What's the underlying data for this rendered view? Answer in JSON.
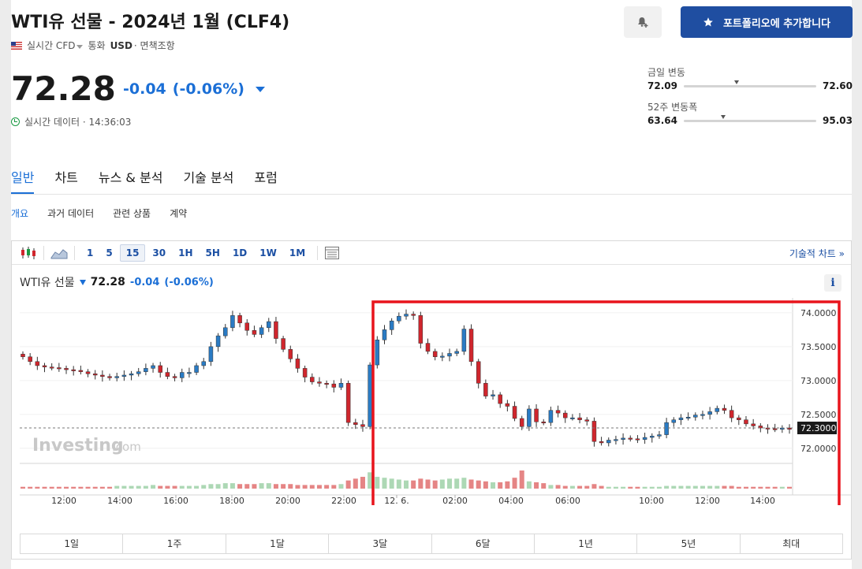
{
  "header": {
    "title": "WTI유 선물 - 2024년 1월 (CLF4)",
    "add_button_label": "포트폴리오에 추가합니다",
    "source": "실시간 CFD",
    "currency_label": "통화",
    "currency": "USD",
    "tax": "· 면책조항"
  },
  "quote": {
    "price": "72.28",
    "change": "-0.04",
    "change_pct": "(-0.06%)",
    "realtime_text": "실시간 데이터 · 14:36:03"
  },
  "ranges": {
    "day_label": "금일 변동",
    "day_low": "72.09",
    "day_high": "72.60",
    "day_pos": 0.38,
    "week52_label": "52주 변동폭",
    "week52_low": "63.64",
    "week52_high": "95.03",
    "week52_pos": 0.28
  },
  "tabs": [
    "일반",
    "차트",
    "뉴스 & 분석",
    "기술 분석",
    "포럼"
  ],
  "subtabs": [
    "개요",
    "과거 데이터",
    "관련 상품",
    "계약"
  ],
  "toolbar": {
    "intervals": [
      "1",
      "5",
      "15",
      "30",
      "1H",
      "5H",
      "1D",
      "1W",
      "1M"
    ],
    "active_interval": "15",
    "tech_chart_link": "기술적 차트 »"
  },
  "chart_head": {
    "name": "WTI유 선물",
    "price": "72.28",
    "change": "-0.04",
    "change_pct": "(-0.06%)"
  },
  "watermark": {
    "brand": "Investing",
    "suffix": ".com"
  },
  "periods": [
    "1일",
    "1주",
    "1달",
    "3달",
    "6달",
    "1년",
    "5년",
    "최대"
  ],
  "colors": {
    "up": "#2a7bc4",
    "down": "#d0262d",
    "accent": "#1b6fd6",
    "button": "#1f4ea1",
    "highlight": "#e8141c"
  },
  "chart_data": {
    "type": "candlestick",
    "interval": "15m",
    "x_ticks": [
      "12:00",
      "14:00",
      "16:00",
      "18:00",
      "20:00",
      "22:00",
      "12. 6.",
      "02:00",
      "04:00",
      "06:00",
      "10:00",
      "12:00",
      "14:00"
    ],
    "y_ticks": [
      "74.0000",
      "73.5000",
      "73.0000",
      "72.5000",
      "72.0000"
    ],
    "ylim": [
      71.8,
      74.15
    ],
    "current_price_label": "72.3000",
    "current_price": 72.3,
    "closes": [
      73.35,
      73.28,
      73.22,
      73.2,
      73.19,
      73.18,
      73.16,
      73.15,
      73.13,
      73.1,
      73.08,
      73.06,
      73.04,
      73.06,
      73.08,
      73.1,
      73.13,
      73.18,
      73.22,
      73.12,
      73.06,
      73.04,
      73.12,
      73.12,
      73.22,
      73.28,
      73.5,
      73.66,
      73.78,
      73.96,
      73.85,
      73.74,
      73.68,
      73.78,
      73.87,
      73.62,
      73.46,
      73.32,
      73.18,
      73.05,
      72.98,
      72.96,
      72.95,
      72.9,
      72.96,
      72.38,
      72.35,
      72.32,
      73.23,
      73.6,
      73.75,
      73.88,
      73.95,
      73.98,
      73.96,
      73.55,
      73.43,
      73.35,
      73.36,
      73.4,
      73.43,
      73.76,
      73.28,
      72.96,
      72.77,
      72.79,
      72.66,
      72.62,
      72.44,
      72.32,
      72.58,
      72.39,
      72.38,
      72.56,
      72.52,
      72.45,
      72.45,
      72.42,
      72.4,
      72.1,
      72.08,
      72.12,
      72.13,
      72.15,
      72.14,
      72.13,
      72.16,
      72.18,
      72.2,
      72.38,
      72.42,
      72.45,
      72.46,
      72.49,
      72.5,
      72.54,
      72.59,
      72.56,
      72.45,
      72.42,
      72.36,
      72.33,
      72.3,
      72.29,
      72.28,
      72.3,
      72.28
    ],
    "volumes": [
      2,
      2,
      2,
      2,
      2,
      2,
      2,
      2,
      2,
      2,
      2,
      2,
      2,
      3,
      3,
      3,
      3,
      3,
      4,
      3,
      3,
      3,
      3,
      3,
      3,
      4,
      5,
      5,
      6,
      6,
      5,
      5,
      5,
      6,
      6,
      5,
      5,
      5,
      4,
      4,
      4,
      4,
      4,
      4,
      5,
      9,
      11,
      13,
      18,
      13,
      12,
      11,
      10,
      9,
      9,
      11,
      10,
      9,
      10,
      11,
      11,
      12,
      10,
      9,
      8,
      7,
      7,
      8,
      12,
      20,
      8,
      7,
      6,
      4,
      4,
      3,
      3,
      3,
      3,
      5,
      3,
      2,
      2,
      2,
      2,
      2,
      2,
      2,
      2,
      3,
      3,
      3,
      3,
      3,
      3,
      3,
      3,
      3,
      3,
      2,
      2,
      2,
      2,
      2,
      2,
      2,
      2
    ]
  }
}
